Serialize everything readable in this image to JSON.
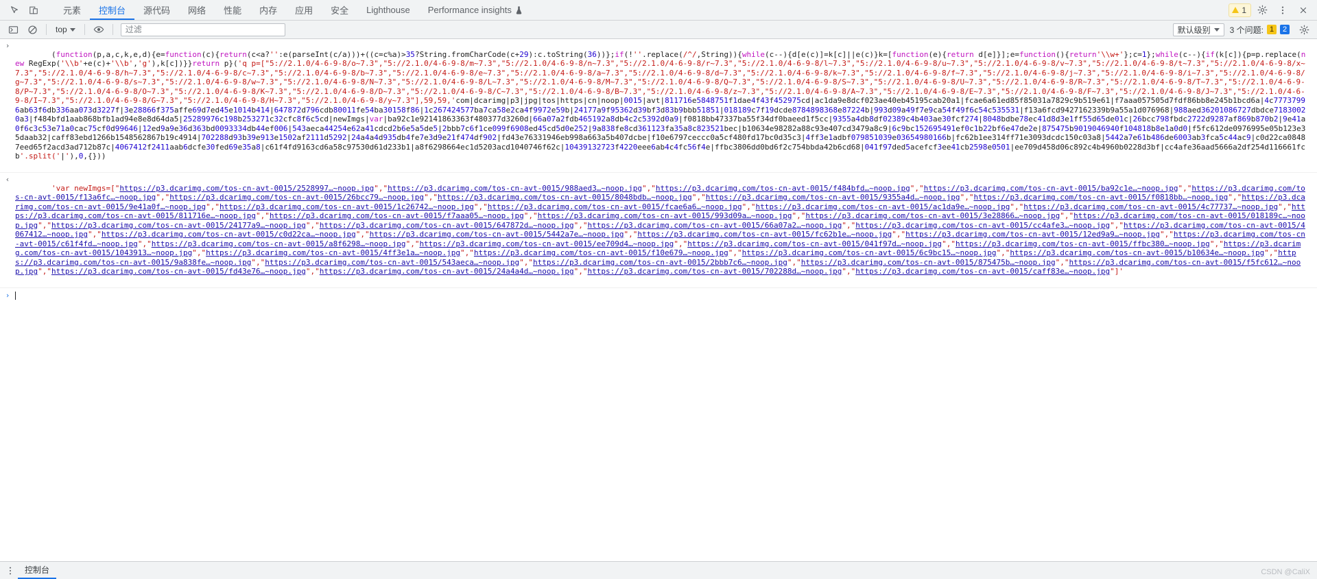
{
  "window": {
    "title": "Chrome DevTools"
  },
  "tabbar": {
    "inspect_icon": "inspect-element-icon",
    "device_icon": "device-toolbar-icon",
    "tabs": [
      {
        "label": "元素",
        "id": "elements",
        "active": false
      },
      {
        "label": "控制台",
        "id": "console",
        "active": true
      },
      {
        "label": "源代码",
        "id": "sources",
        "active": false
      },
      {
        "label": "网络",
        "id": "network",
        "active": false
      },
      {
        "label": "性能",
        "id": "performance",
        "active": false
      },
      {
        "label": "内存",
        "id": "memory",
        "active": false
      },
      {
        "label": "应用",
        "id": "application",
        "active": false
      },
      {
        "label": "安全",
        "id": "security",
        "active": false
      },
      {
        "label": "Lighthouse",
        "id": "lighthouse",
        "active": false
      },
      {
        "label": "Performance insights",
        "id": "performance-insights",
        "active": false,
        "flask": "⚗"
      }
    ],
    "issue_count": "1",
    "settings_icon": "gear-icon",
    "more_icon": "more-vertical-icon",
    "close_icon": "close-icon"
  },
  "console_toolbar": {
    "clear_icon": "clear-console-icon",
    "noentry_icon": "no-entry-icon",
    "context_label": "top",
    "eye_icon": "live-expression-eye-icon",
    "filter_placeholder": "过滤",
    "filter_value": "",
    "level_label": "默认级别",
    "issues_text": "3 个问题:",
    "warning_count": "1",
    "info_count": "2",
    "settings_icon": "console-settings-gear-icon"
  },
  "console": {
    "messages": [
      {
        "gutter": "›",
        "kind": "input-expression",
        "text": "(function(p,a,c,k,e,d){e=function(c){return(c<a?'':e(parseInt(c/a)))+((c=c%a)>35?String.fromCharCode(c+29):c.toString(36))};if(!''.replace(/^/,String)){while(c--){d[e(c)]=k[c]||e(c)}k=[function(e){return d[e]}];e=function(){return'\\\\w+'};c=1};while(c--){if(k[c]){p=p.replace(new RegExp('\\\\b'+e(c)+'\\\\b','g'),k[c])}}return p}('q p=[\"5://2.1.0/4-6-9-8/o~7.3\",\"5://2.1.0/4-6-9-8/m~7.3\",\"5://2.1.0/4-6-9-8/n~7.3\",\"5://2.1.0/4-6-9-8/r~7.3\",\"5://2.1.0/4-6-9-8/l~7.3\",\"5://2.1.0/4-6-9-8/u~7.3\",\"5://2.1.0/4-6-9-8/v~7.3\",\"5://2.1.0/4-6-9-8/t~7.3\",\"5://2.1.0/4-6-9-8/x~7.3\",\"5://2.1.0/4-6-9-8/h~7.3\",\"5://2.1.0/4-6-9-8/c~7.3\",\"5://2.1.0/4-6-9-8/b~7.3\",\"5://2.1.0/4-6-9-8/e~7.3\",\"5://2.1.0/4-6-9-8/a~7.3\",\"5://2.1.0/4-6-9-8/d~7.3\",\"5://2.1.0/4-6-9-8/k~7.3\",\"5://2.1.0/4-6-9-8/f~7.3\",\"5://2.1.0/4-6-9-8/j~7.3\",\"5://2.1.0/4-6-9-8/i~7.3\",\"5://2.1.0/4-6-9-8/g~7.3\",\"5://2.1.0/4-6-9-8/s~7.3\",\"5://2.1.0/4-6-9-8/w~7.3\",\"5://2.1.0/4-6-9-8/N~7.3\",\"5://2.1.0/4-6-9-8/L~7.3\",\"5://2.1.0/4-6-9-8/M~7.3\",\"5://2.1.0/4-6-9-8/Q~7.3\",\"5://2.1.0/4-6-9-8/S~7.3\",\"5://2.1.0/4-6-9-8/U~7.3\",\"5://2.1.0/4-6-9-8/R~7.3\",\"5://2.1.0/4-6-9-8/T~7.3\",\"5://2.1.0/4-6-9-8/P~7.3\",\"5://2.1.0/4-6-9-8/O~7.3\",\"5://2.1.0/4-6-9-8/K~7.3\",\"5://2.1.0/4-6-9-8/D~7.3\",\"5://2.1.0/4-6-9-8/C~7.3\",\"5://2.1.0/4-6-9-8/B~7.3\",\"5://2.1.0/4-6-9-8/z~7.3\",\"5://2.1.0/4-6-9-8/A~7.3\",\"5://2.1.0/4-6-9-8/E~7.3\",\"5://2.1.0/4-6-9-8/F~7.3\",\"5://2.1.0/4-6-9-8/J~7.3\",\"5://2.1.0/4-6-9-8/I~7.3\",\"5://2.1.0/4-6-9-8/G~7.3\",\"5://2.1.0/4-6-9-8/H~7.3\",\"5://2.1.0/4-6-9-8/y~7.3\"],59,59,'com|dcarimg|p3|jpg|tos|https|cn|noop|0015|avt|811716e5848751f1dae4f43f452975cd|ac1da9e8dcf023ae40eb45195cab20a1|fcae6a61ed85f85031a7829c9b519e61|f7aaa057505d7fdf86bb8e245b1bcd6a|4c77737996ab63f6db336aa073d3227f|3e28866f375affe69d7ed45e1014b414|647872d796cdb80011fe54ba30158f86|1c267424577ba7ca58e2ca4f9972e59b|24177a9f95362d39bf3d83b9bbb51851|018189c7f19dcde8784898368e87224b|993d09a49f7e9ca54f49f6c54c535531|f13a6fcd9427162339b9a55a1d076968|988aed36201086727dbdce71830020a3|f484bfd1aab868bfb1ad94e8e8d64da5|25289976c198b253271c32cfc8f6c5cd|newImgs|var|ba92c1e92141863363f480377d3260d|66a07a2fdb465192a8db4c2c5392d0a9|f0818bb47337ba55f34df0baeed1f5cc|9355a4db8df02389c4b403ae30fcf274|8048bdbe78ec41d8d3e1ff55d65de01c|26bcc798fbdc2722d9287af869b870b2|9e41a0f6c3c53e71a0cac75cf0d99646|12ed9a9e36d363bd0093334db44ef006|543aeca44254e62a41cdcd2b6e5a5de5|2bbb7c6f1ce099f6908ed45cd5d0e252|9a838fe8cd361123fa35a8c823521bec|b10634e98282a88c93e407cd3479a8c9|6c9bc152695491ef0c1b22bf6e47de2e|875475b9019046940f104818b8e1a0d0|f5fc612de0976995e05b123e35daab32|caff83ebd1266b1548562867b19c4914|702288d93b39e913e1502af2111d5292|24a4a4d935db4fe7e3d9e21f474df902|fd43e76331946eb998a663a5b407dcbe|f10e6797ceccc0a5cf480fd17bc0d35c3|4ff3e1adbf079851039e03654980166b|fc62b1ee314ff71e3093dcdc150c03a8|5442a7e61b486de6003ab3fca5c44ac9|c0d22ca08487eed65f2acd3ad712b87c|4067412f2411aab6dcfe30fed69e35a8|c61f4fd9163cd6a58c97530d61d233b1|a8f6298664ec1d5203acd1040746f62c|10439132723f4220eee6ab4c4fc56f4e|ffbc3806dd0bd6f2c754bbda42b6cd68|041f97ded5acefcf3ee41cb2598e0501|ee709d458d06c892c4b4960b0228d3bf|cc4afe36aad5666a2df254d116661fcb'.split('|'),0,{}))",
        "note": "minified-packer-input"
      },
      {
        "gutter": "‹",
        "kind": "result",
        "prefix": "'var newImgs=[",
        "suffix": "]'",
        "urls": [
          "https://p3.dcarimg.com/tos-cn-avt-0015/2528997…~noop.jpg",
          "https://p3.dcarimg.com/tos-cn-avt-0015/988aed3…~noop.jpg",
          "https://p3.dcarimg.com/tos-cn-avt-0015/f484bfd…~noop.jpg",
          "https://p3.dcarimg.com/tos-cn-avt-0015/ba92c1e…~noop.jpg",
          "https://p3.dcarimg.com/tos-cn-avt-0015/f13a6fc…~noop.jpg",
          "https://p3.dcarimg.com/tos-cn-avt-0015/26bcc79…~noop.jpg",
          "https://p3.dcarimg.com/tos-cn-avt-0015/8048bdb…~noop.jpg",
          "https://p3.dcarimg.com/tos-cn-avt-0015/9355a4d…~noop.jpg",
          "https://p3.dcarimg.com/tos-cn-avt-0015/f0818bb…~noop.jpg",
          "https://p3.dcarimg.com/tos-cn-avt-0015/9e41a0f…~noop.jpg",
          "https://p3.dcarimg.com/tos-cn-avt-0015/1c26742…~noop.jpg",
          "https://p3.dcarimg.com/tos-cn-avt-0015/fcae6a6…~noop.jpg",
          "https://p3.dcarimg.com/tos-cn-avt-0015/ac1da9e…~noop.jpg",
          "https://p3.dcarimg.com/tos-cn-avt-0015/4c77737…~noop.jpg",
          "https://p3.dcarimg.com/tos-cn-avt-0015/811716e…~noop.jpg",
          "https://p3.dcarimg.com/tos-cn-avt-0015/f7aaa05…~noop.jpg",
          "https://p3.dcarimg.com/tos-cn-avt-0015/993d09a…~noop.jpg",
          "https://p3.dcarimg.com/tos-cn-avt-0015/3e28866…~noop.jpg",
          "https://p3.dcarimg.com/tos-cn-avt-0015/018189c…~noop.jpg",
          "https://p3.dcarimg.com/tos-cn-avt-0015/24177a9…~noop.jpg",
          "https://p3.dcarimg.com/tos-cn-avt-0015/647872d…~noop.jpg",
          "https://p3.dcarimg.com/tos-cn-avt-0015/66a07a2…~noop.jpg",
          "https://p3.dcarimg.com/tos-cn-avt-0015/cc4afe3…~noop.jpg",
          "https://p3.dcarimg.com/tos-cn-avt-0015/4067412…~noop.jpg",
          "https://p3.dcarimg.com/tos-cn-avt-0015/c0d22ca…~noop.jpg",
          "https://p3.dcarimg.com/tos-cn-avt-0015/5442a7e…~noop.jpg",
          "https://p3.dcarimg.com/tos-cn-avt-0015/fc62b1e…~noop.jpg",
          "https://p3.dcarimg.com/tos-cn-avt-0015/12ed9a9…~noop.jpg",
          "https://p3.dcarimg.com/tos-cn-avt-0015/c61f4fd…~noop.jpg",
          "https://p3.dcarimg.com/tos-cn-avt-0015/a8f6298…~noop.jpg",
          "https://p3.dcarimg.com/tos-cn-avt-0015/ee709d4…~noop.jpg",
          "https://p3.dcarimg.com/tos-cn-avt-0015/041f97d…~noop.jpg",
          "https://p3.dcarimg.com/tos-cn-avt-0015/ffbc380…~noop.jpg",
          "https://p3.dcarimg.com/tos-cn-avt-0015/1043913…~noop.jpg",
          "https://p3.dcarimg.com/tos-cn-avt-0015/4ff3e1a…~noop.jpg",
          "https://p3.dcarimg.com/tos-cn-avt-0015/f10e679…~noop.jpg",
          "https://p3.dcarimg.com/tos-cn-avt-0015/6c9bc15…~noop.jpg",
          "https://p3.dcarimg.com/tos-cn-avt-0015/b10634e…~noop.jpg",
          "https://p3.dcarimg.com/tos-cn-avt-0015/9a838fe…~noop.jpg",
          "https://p3.dcarimg.com/tos-cn-avt-0015/543aeca…~noop.jpg",
          "https://p3.dcarimg.com/tos-cn-avt-0015/2bbb7c6…~noop.jpg",
          "https://p3.dcarimg.com/tos-cn-avt-0015/875475b…~noop.jpg",
          "https://p3.dcarimg.com/tos-cn-avt-0015/f5fc612…~noop.jpg",
          "https://p3.dcarimg.com/tos-cn-avt-0015/fd43e76…~noop.jpg",
          "https://p3.dcarimg.com/tos-cn-avt-0015/24a4a4d…~noop.jpg",
          "https://p3.dcarimg.com/tos-cn-avt-0015/702288d…~noop.jpg",
          "https://p3.dcarimg.com/tos-cn-avt-0015/caff83e…~noop.jpg"
        ]
      }
    ],
    "prompt_symbol": "›"
  },
  "drawer": {
    "tab_label": "控制台",
    "more_icon": "drawer-more-icon"
  },
  "watermark": {
    "text": "CSDN @CaliX"
  },
  "colors": {
    "accent": "#1a73e8",
    "toolbar_bg": "#f1f3f4",
    "string_red": "#c41a16",
    "link_blue": "#1a0dab",
    "number_blue": "#1c00cf",
    "keyword_magenta": "#c015c0",
    "warning_yellow": "#f5c518",
    "info_blue": "#1a73e8"
  }
}
